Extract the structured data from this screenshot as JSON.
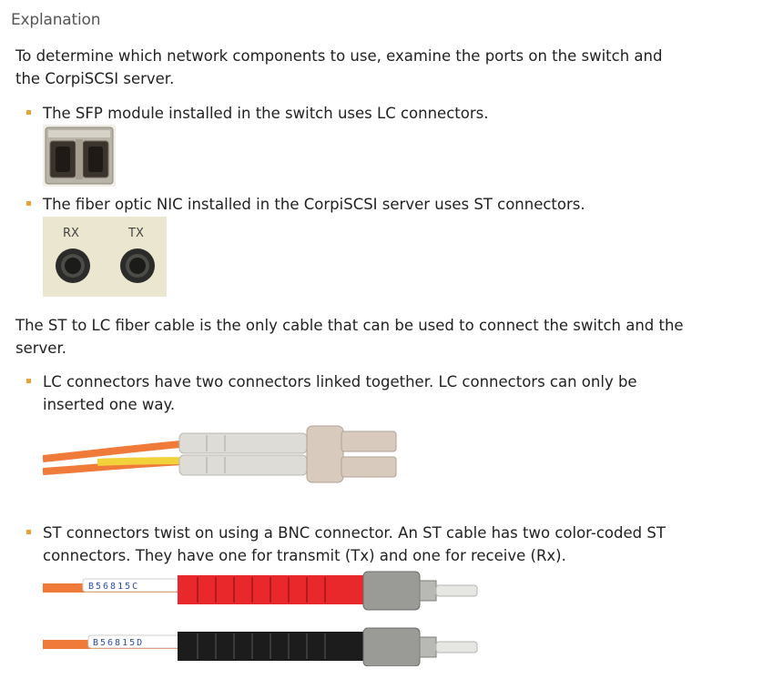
{
  "section": {
    "title": "Explanation"
  },
  "intro": "To determine which network components to use, examine the ports on the switch and the CorpiSCSI server.",
  "bullets_ports": [
    "The SFP module installed in the switch uses LC connectors.",
    "The fiber optic NIC installed in the CorpiSCSI server uses ST connectors."
  ],
  "nic_labels": {
    "rx": "RX",
    "tx": "TX"
  },
  "cable_statement": "The ST to LC fiber cable is the only cable that can be used to connect the switch and the server.",
  "bullets_cables": [
    "LC connectors have two connectors linked together. LC connectors can only be inserted one way.",
    "ST connectors twist on using a BNC connector. An ST cable has two color-coded ST connectors. They have one for transmit (Tx) and one for receive (Rx)."
  ],
  "cable_labels": {
    "st_red": "B56815C",
    "st_black": "B56815D"
  },
  "colors": {
    "bullet_marker": "#e8a33b",
    "cable_orange": "#f07a3a",
    "cable_yellow": "#f2d23a",
    "st_red": "#e8282a",
    "st_black": "#1c1c1c"
  }
}
